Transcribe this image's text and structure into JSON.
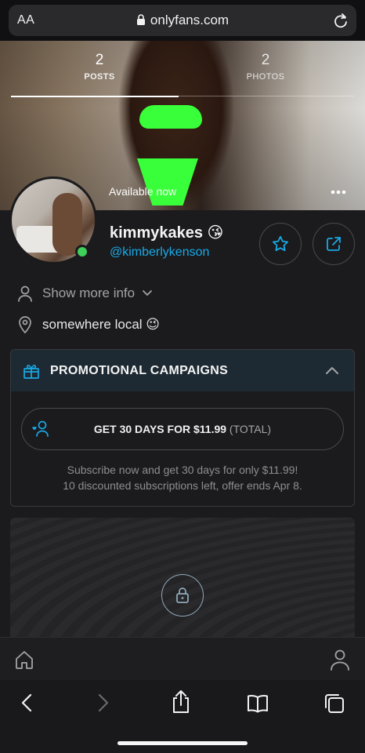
{
  "browser": {
    "text_size_label": "AA",
    "url": "onlyfans.com"
  },
  "profile_tabs": [
    {
      "count": "2",
      "label": "POSTS"
    },
    {
      "count": "2",
      "label": "PHOTOS"
    }
  ],
  "cover": {
    "status_text": "Available now"
  },
  "profile": {
    "name": "kimmykakes 😘",
    "handle": "@kimberlykenson",
    "show_more_label": "Show more info",
    "location": "somewhere local 😉"
  },
  "promotion": {
    "header": "PROMOTIONAL CAMPAIGNS",
    "button_main": "GET 30 DAYS FOR $11.99",
    "button_suffix": "(TOTAL)",
    "desc_line1": "Subscribe now and get 30 days for only $11.99!",
    "desc_line2": "10 discounted subscriptions left, offer ends Apr 8."
  },
  "colors": {
    "accent": "#18a9e6",
    "online": "#3fcf5b",
    "promo_header_bg": "#1d2a33"
  }
}
